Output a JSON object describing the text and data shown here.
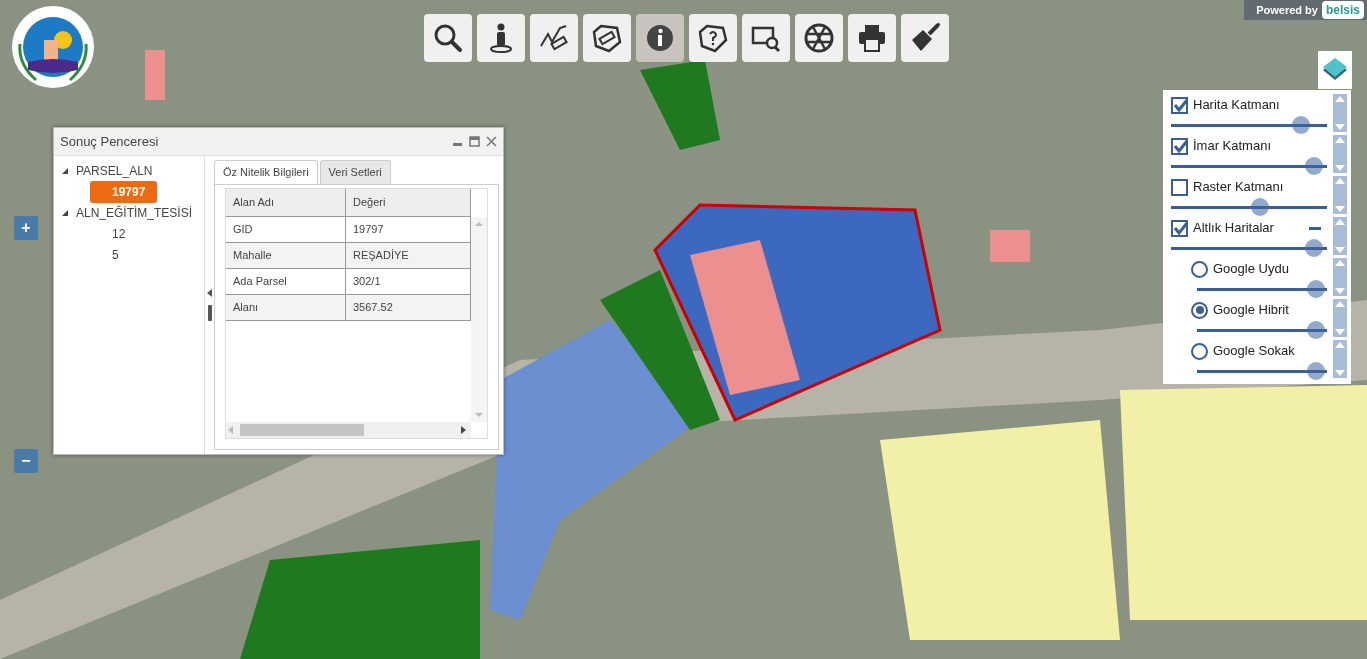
{
  "branding": {
    "powered_by": "Powered by",
    "vendor": "belsis"
  },
  "toolbar": [
    {
      "kind": "search",
      "selected": false
    },
    {
      "kind": "person",
      "selected": false
    },
    {
      "kind": "measure-line",
      "selected": false
    },
    {
      "kind": "measure-area",
      "selected": false
    },
    {
      "kind": "info",
      "selected": true
    },
    {
      "kind": "query-area",
      "selected": false
    },
    {
      "kind": "zoom-box",
      "selected": false
    },
    {
      "kind": "globe",
      "selected": false
    },
    {
      "kind": "print",
      "selected": false
    },
    {
      "kind": "clear",
      "selected": false
    }
  ],
  "zoom_controls": [
    "+",
    "−"
  ],
  "result_window": {
    "title": "Sonuç Penceresi",
    "tree": [
      {
        "label": "PARSEL_ALN",
        "expanded": true,
        "children": [
          {
            "label": "19797",
            "selected": true
          }
        ]
      },
      {
        "label": "ALN_EĞİTİM_TESİSİ",
        "expanded": true,
        "children": [
          {
            "label": "12",
            "selected": false
          },
          {
            "label": "5",
            "selected": false
          }
        ]
      }
    ],
    "tabs": [
      {
        "label": "Öz Nitelik Bilgileri",
        "selected": true
      },
      {
        "label": "Veri Setleri",
        "selected": false
      }
    ],
    "table": {
      "columns": [
        "Alan Adı",
        "Değeri"
      ],
      "rows": [
        [
          "GID",
          "19797"
        ],
        [
          "Mahalle",
          "REŞADİYE"
        ],
        [
          "Ada Parsel",
          "302/1"
        ],
        [
          "Alanı",
          "3567.52"
        ]
      ]
    }
  },
  "layers": [
    {
      "kind": "checkbox",
      "label": "Harita Katmanı",
      "checked": true,
      "level": 0.88
    },
    {
      "kind": "checkbox",
      "label": "İmar Katmanı",
      "checked": true,
      "level": 0.97
    },
    {
      "kind": "checkbox",
      "label": "Raster Katmanı",
      "checked": false,
      "level": 0.58
    },
    {
      "kind": "checkbox",
      "label": "Altlık Haritalar",
      "checked": true,
      "level": 0.97,
      "expanded": true,
      "children": [
        {
          "kind": "radio",
          "label": "Google Uydu",
          "selected": false,
          "level": 0.98
        },
        {
          "kind": "radio",
          "label": "Google Hibrit",
          "selected": true,
          "level": 0.98
        },
        {
          "kind": "radio",
          "label": "Google Sokak",
          "selected": false,
          "level": 0.98
        }
      ]
    }
  ]
}
